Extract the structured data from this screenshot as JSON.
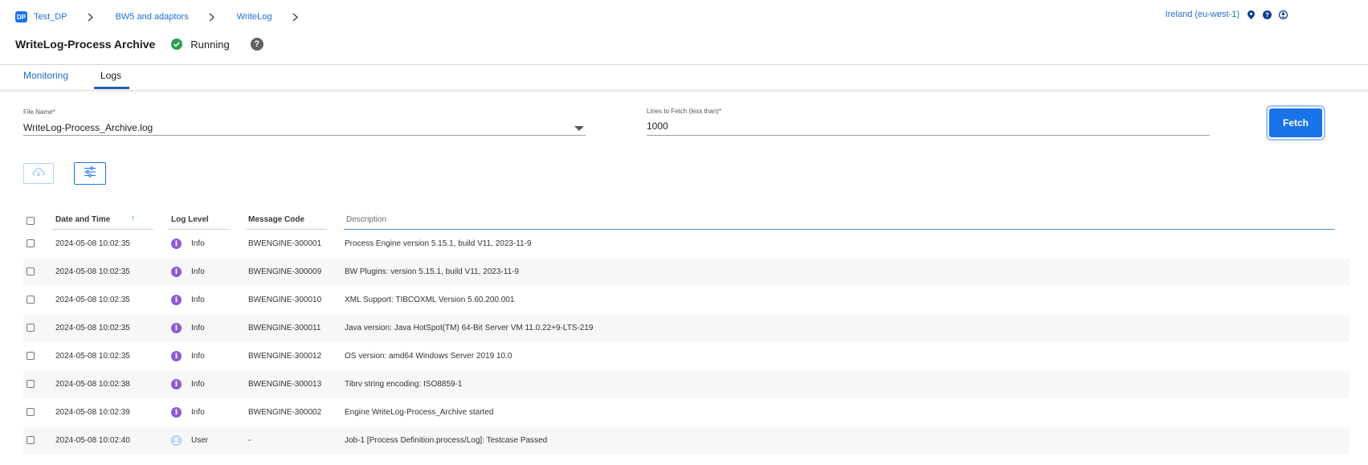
{
  "breadcrumb": {
    "badge": "DP",
    "items": [
      "Test_DP",
      "BW5 and adaptors",
      "WriteLog"
    ]
  },
  "header": {
    "title": "WriteLog-Process Archive",
    "status": "Running",
    "help": "?",
    "region": "Ireland (eu-west-1)"
  },
  "tabs": [
    "Monitoring",
    "Logs"
  ],
  "active_tab": "Logs",
  "form": {
    "file_name_label": "File Name*",
    "file_name_value": "WriteLog-Process_Archive.log",
    "lines_label": "Lines to Fetch (less than)*",
    "lines_value": "1000",
    "fetch_label": "Fetch"
  },
  "table": {
    "columns": [
      "Date and Time",
      "Log Level",
      "Message Code",
      "Description"
    ],
    "sort_indicator": "↑",
    "rows": [
      {
        "datetime": "2024-05-08 10:02:35",
        "level": "Info",
        "level_icon": "info-icon",
        "code": "BWENGINE-300001",
        "description": "Process Engine version 5.15.1, build V11, 2023-11-9"
      },
      {
        "datetime": "2024-05-08 10:02:35",
        "level": "Info",
        "level_icon": "info-icon",
        "code": "BWENGINE-300009",
        "description": "BW Plugins: version 5.15.1, build V11, 2023-11-9"
      },
      {
        "datetime": "2024-05-08 10:02:35",
        "level": "Info",
        "level_icon": "info-icon",
        "code": "BWENGINE-300010",
        "description": "XML Support: TIBCOXML Version 5.60.200.001"
      },
      {
        "datetime": "2024-05-08 10:02:35",
        "level": "Info",
        "level_icon": "info-icon",
        "code": "BWENGINE-300011",
        "description": "Java version: Java HotSpot(TM) 64-Bit Server VM 11.0.22+9-LTS-219"
      },
      {
        "datetime": "2024-05-08 10:02:35",
        "level": "Info",
        "level_icon": "info-icon",
        "code": "BWENGINE-300012",
        "description": "OS version: amd64 Windows Server 2019 10.0"
      },
      {
        "datetime": "2024-05-08 10:02:38",
        "level": "Info",
        "level_icon": "info-icon",
        "code": "BWENGINE-300013",
        "description": "Tibrv string encoding: ISO8859-1"
      },
      {
        "datetime": "2024-05-08 10:02:39",
        "level": "Info",
        "level_icon": "info-icon",
        "code": "BWENGINE-300002",
        "description": "Engine WriteLog-Process_Archive started"
      },
      {
        "datetime": "2024-05-08 10:02:40",
        "level": "User",
        "level_icon": "user-icon",
        "code": "-",
        "description": "Job-1 [Process Definition.process/Log]: Testcase Passed"
      }
    ]
  },
  "colors": {
    "accent": "#1a73e8",
    "link": "#1f6fd1",
    "running": "#2e9e4f",
    "info": "#8b5cd6"
  }
}
